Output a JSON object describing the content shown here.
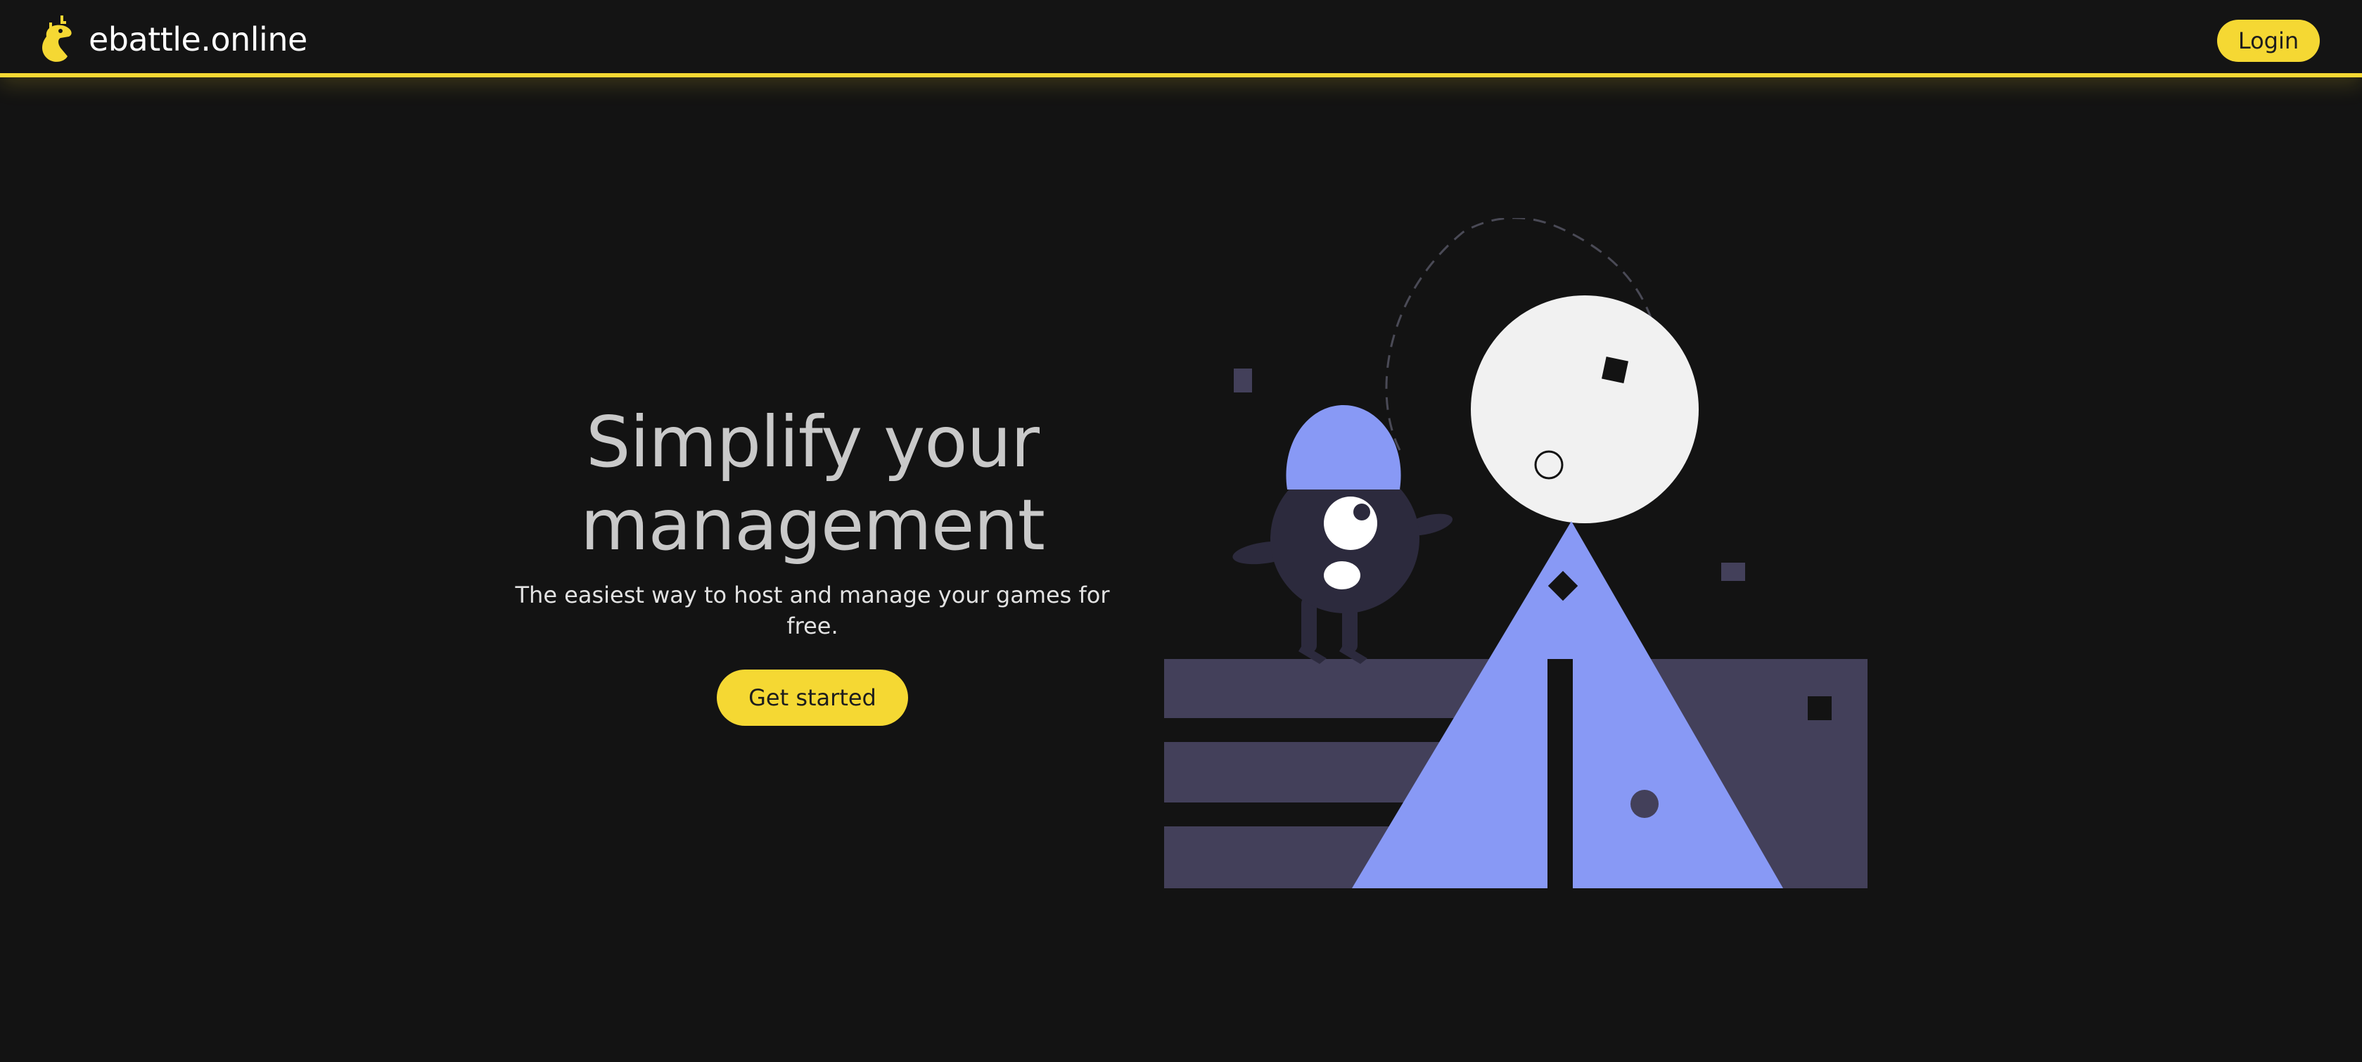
{
  "navbar": {
    "brand_name": "ebattle.online",
    "login_label": "Login",
    "logo_icon": "giraffe-head-icon"
  },
  "hero": {
    "title_line1": "Simplify your",
    "title_line2": "management",
    "subtitle": "The easiest way to host and manage your games for free.",
    "cta_label": "Get started"
  },
  "colors": {
    "background": "#131313",
    "accent": "#f5d833",
    "illustration_primary": "#8899f5",
    "illustration_secondary": "#43405a",
    "moon": "#f1f1f1"
  }
}
